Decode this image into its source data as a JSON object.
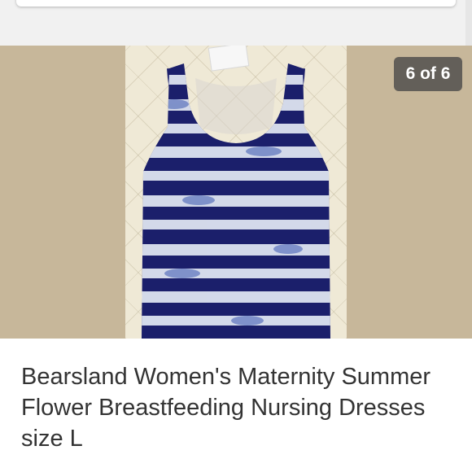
{
  "gallery": {
    "counter": "6 of 6",
    "photo_subject": "navy and white tie-dye racerback tank dress"
  },
  "listing": {
    "title": "Bearsland Women's Maternity Summer Flower Breastfeeding Nursing Dresses size L"
  },
  "colors": {
    "top_band": "#f1f1f1",
    "gallery_background": "#c7b79a",
    "quilt": "#efe9d6",
    "dress_navy": "#1b1f6b",
    "tie_dye_white": "#e8eef8",
    "title_text": "#333333"
  }
}
